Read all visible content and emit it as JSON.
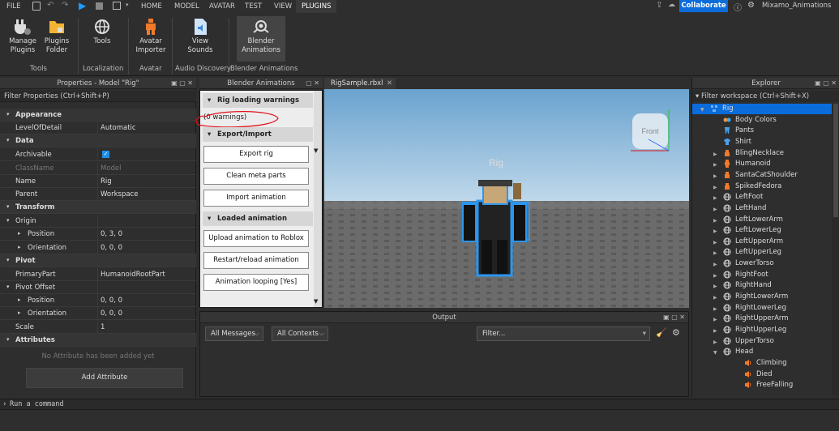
{
  "menubar": {
    "file": "FILE",
    "tabs": [
      "HOME",
      "MODEL",
      "AVATAR",
      "TEST",
      "VIEW",
      "PLUGINS"
    ],
    "collaborate": "Collaborate",
    "user": "Mixamo_Animations"
  },
  "ribbon": {
    "buttons": [
      {
        "label1": "Manage",
        "label2": "Plugins"
      },
      {
        "label1": "Plugins",
        "label2": "Folder"
      },
      {
        "label1": "Tools",
        "label2": ""
      },
      {
        "label1": "Avatar",
        "label2": "Importer"
      },
      {
        "label1": "View",
        "label2": "Sounds"
      },
      {
        "label1": "Blender",
        "label2": "Animations"
      }
    ],
    "groups": [
      "Tools",
      "Localization",
      "Avatar",
      "Audio Discovery",
      "Blender Animations"
    ]
  },
  "properties": {
    "title": "Properties - Model \"Rig\"",
    "filter": "Filter Properties (Ctrl+Shift+P)",
    "rows": [
      {
        "k": "Appearance",
        "v": "",
        "section": true
      },
      {
        "k": "LevelOfDetail",
        "v": "Automatic"
      },
      {
        "k": "Data",
        "v": "",
        "section": true
      },
      {
        "k": "Archivable",
        "v": ""
      },
      {
        "k": "ClassName",
        "v": "Model"
      },
      {
        "k": "Name",
        "v": "Rig"
      },
      {
        "k": "Parent",
        "v": "Workspace"
      },
      {
        "k": "Transform",
        "v": "",
        "section": true
      },
      {
        "k": "Origin",
        "v": ""
      },
      {
        "k": "Position",
        "v": "0, 3, 0"
      },
      {
        "k": "Orientation",
        "v": "0, 0, 0"
      },
      {
        "k": "Pivot",
        "v": "",
        "section": true
      },
      {
        "k": "PrimaryPart",
        "v": "HumanoidRootPart"
      },
      {
        "k": "Pivot Offset",
        "v": ""
      },
      {
        "k": "Position",
        "v": "0, 0, 0"
      },
      {
        "k": "Orientation",
        "v": "0, 0, 0"
      },
      {
        "k": "Scale",
        "v": "1"
      },
      {
        "k": "Attributes",
        "v": "",
        "section": true
      }
    ],
    "no_attr": "No Attribute has been added yet",
    "add_attr": "Add Attribute"
  },
  "blender": {
    "title": "Blender Animations",
    "sec1": "Rig loading warnings",
    "warnings": "(0 warnings)",
    "sec2": "Export/Import",
    "btn_export": "Export rig",
    "btn_clean": "Clean meta parts",
    "btn_import": "Import animation",
    "sec3": "Loaded animation",
    "btn_upload": "Upload animation to Roblox",
    "btn_restart": "Restart/reload animation",
    "btn_loop": "Animation looping [Yes]"
  },
  "editor": {
    "tab": "RigSample.rbxl",
    "rig_label": "Rig",
    "view_cube": "Front"
  },
  "output": {
    "title": "Output",
    "messages": "All Messages",
    "contexts": "All Contexts",
    "filter": "Filter..."
  },
  "explorer": {
    "title": "Explorer",
    "filter": "Filter workspace (Ctrl+Shift+X)",
    "items": [
      {
        "label": "Rig",
        "icon": "model",
        "indent": 1,
        "expand": "open",
        "selected": true
      },
      {
        "label": "Body Colors",
        "icon": "bodycolors",
        "indent": 2,
        "expand": ""
      },
      {
        "label": "Pants",
        "icon": "pants",
        "indent": 2,
        "expand": ""
      },
      {
        "label": "Shirt",
        "icon": "shirt",
        "indent": 2,
        "expand": ""
      },
      {
        "label": "BlingNecklace",
        "icon": "accessory",
        "indent": 2,
        "expand": "closed"
      },
      {
        "label": "Humanoid",
        "icon": "humanoid",
        "indent": 2,
        "expand": "closed"
      },
      {
        "label": "SantaCatShoulder",
        "icon": "accessory",
        "indent": 2,
        "expand": "closed"
      },
      {
        "label": "SpikedFedora",
        "icon": "accessory",
        "indent": 2,
        "expand": "closed"
      },
      {
        "label": "LeftFoot",
        "icon": "mesh",
        "indent": 2,
        "expand": "closed"
      },
      {
        "label": "LeftHand",
        "icon": "mesh",
        "indent": 2,
        "expand": "closed"
      },
      {
        "label": "LeftLowerArm",
        "icon": "mesh",
        "indent": 2,
        "expand": "closed"
      },
      {
        "label": "LeftLowerLeg",
        "icon": "mesh",
        "indent": 2,
        "expand": "closed"
      },
      {
        "label": "LeftUpperArm",
        "icon": "mesh",
        "indent": 2,
        "expand": "closed"
      },
      {
        "label": "LeftUpperLeg",
        "icon": "mesh",
        "indent": 2,
        "expand": "closed"
      },
      {
        "label": "LowerTorso",
        "icon": "mesh",
        "indent": 2,
        "expand": "closed"
      },
      {
        "label": "RightFoot",
        "icon": "mesh",
        "indent": 2,
        "expand": "closed"
      },
      {
        "label": "RightHand",
        "icon": "mesh",
        "indent": 2,
        "expand": "closed"
      },
      {
        "label": "RightLowerArm",
        "icon": "mesh",
        "indent": 2,
        "expand": "closed"
      },
      {
        "label": "RightLowerLeg",
        "icon": "mesh",
        "indent": 2,
        "expand": "closed"
      },
      {
        "label": "RightUpperArm",
        "icon": "mesh",
        "indent": 2,
        "expand": "closed"
      },
      {
        "label": "RightUpperLeg",
        "icon": "mesh",
        "indent": 2,
        "expand": "closed"
      },
      {
        "label": "UpperTorso",
        "icon": "mesh",
        "indent": 2,
        "expand": "closed"
      },
      {
        "label": "Head",
        "icon": "mesh",
        "indent": 2,
        "expand": "open"
      },
      {
        "label": "Climbing",
        "icon": "sound",
        "indent": 3,
        "expand": ""
      },
      {
        "label": "Died",
        "icon": "sound",
        "indent": 3,
        "expand": ""
      },
      {
        "label": "FreeFalling",
        "icon": "sound",
        "indent": 3,
        "expand": ""
      }
    ]
  },
  "command": {
    "placeholder": "Run a command"
  },
  "colors": {
    "accent": "#0b6cda",
    "selected": "#0b6cda",
    "annotation": "#e0101a"
  }
}
